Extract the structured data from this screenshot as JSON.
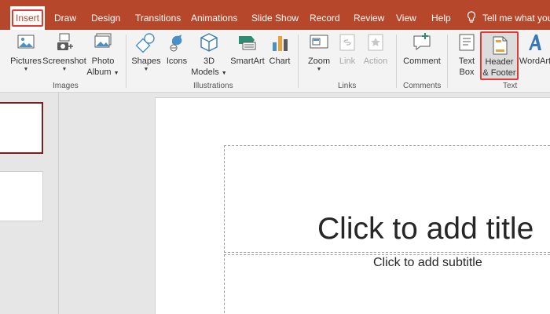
{
  "tabs": [
    {
      "key": "insert",
      "label": "Insert",
      "active": true
    },
    {
      "key": "draw",
      "label": "Draw"
    },
    {
      "key": "design",
      "label": "Design"
    },
    {
      "key": "transitions",
      "label": "Transitions"
    },
    {
      "key": "animations",
      "label": "Animations"
    },
    {
      "key": "slideshow",
      "label": "Slide Show"
    },
    {
      "key": "record",
      "label": "Record"
    },
    {
      "key": "review",
      "label": "Review"
    },
    {
      "key": "view",
      "label": "View"
    },
    {
      "key": "help",
      "label": "Help"
    }
  ],
  "tell_me": "Tell me what you",
  "ribbon": {
    "images": {
      "label": "Images",
      "pictures": "Pictures",
      "screenshot": "Screenshot",
      "photo_album_1": "Photo",
      "photo_album_2": "Album"
    },
    "illustrations": {
      "label": "Illustrations",
      "shapes": "Shapes",
      "icons": "Icons",
      "models_1": "3D",
      "models_2": "Models",
      "smartart": "SmartArt",
      "chart": "Chart"
    },
    "links": {
      "label": "Links",
      "zoom": "Zoom",
      "link": "Link",
      "action": "Action"
    },
    "comments": {
      "label": "Comments",
      "comment": "Comment"
    },
    "text": {
      "label": "Text",
      "textbox_1": "Text",
      "textbox_2": "Box",
      "hf_1": "Header",
      "hf_2": "& Footer",
      "wordart": "WordArt"
    }
  },
  "slide": {
    "title_placeholder": "Click to add title",
    "subtitle_placeholder": "Click to add subtitle"
  },
  "colors": {
    "accent": "#b7472a",
    "highlight": "#e53935"
  }
}
